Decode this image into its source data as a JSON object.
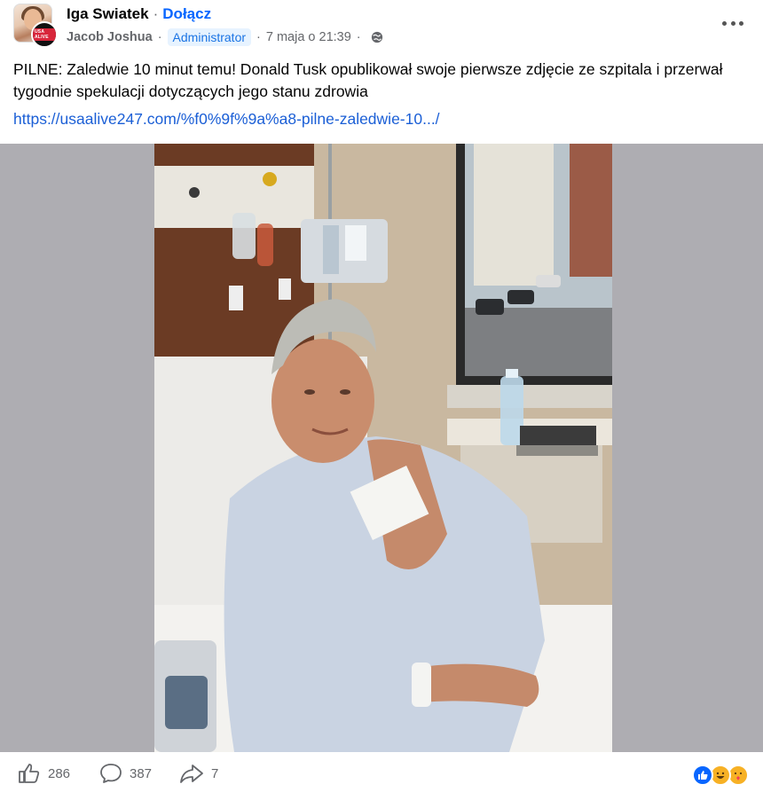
{
  "header": {
    "group_name": "Iga Swiatek",
    "dot": "·",
    "join_label": "Dołącz",
    "author": "Jacob Joshua",
    "meta_dot": "·",
    "role_badge": "Administrator",
    "timestamp": "7 maja o 21:39",
    "avatar_badge_text": "USA ALIVE",
    "privacy_icon": "globe-icon",
    "more_icon": "more-options-icon"
  },
  "post": {
    "text": "PILNE: Zaledwie 10 minut temu! Donald Tusk opublikował swoje pierwsze zdjęcie ze szpitala i przerwał tygodnie spekulacji dotyczących jego stanu zdrowia",
    "link": "https://usaalive247.com/%f0%9f%9a%a8-pilne-zaledwie-10.../"
  },
  "actions": {
    "likes": "286",
    "comments": "387",
    "shares": "7"
  },
  "colors": {
    "link": "#1b5fd6",
    "join": "#0866ff",
    "badge_bg": "#e7f3ff",
    "badge_text": "#1b74e4",
    "meta": "#65676b",
    "media_bg": "#aeadb2"
  }
}
